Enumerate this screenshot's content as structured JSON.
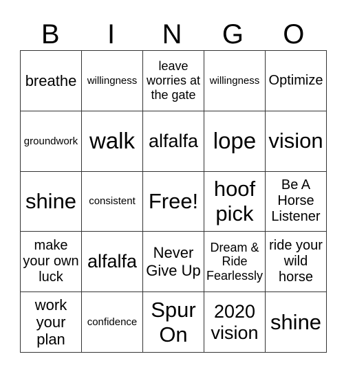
{
  "title_letters": [
    "B",
    "I",
    "N",
    "G",
    "O"
  ],
  "rows": [
    [
      "breathe",
      "willingness",
      "leave worries at the gate",
      "willingness",
      "Optimize"
    ],
    [
      "groundwork",
      "walk",
      "alfalfa",
      "lope",
      "vision"
    ],
    [
      "shine",
      "consistent",
      "Free!",
      "hoof pick",
      "Be A Horse Listener"
    ],
    [
      "make your own luck",
      "alfalfa",
      "Never Give Up",
      "Dream & Ride Fearlessly",
      "ride your wild horse"
    ],
    [
      "work your plan",
      "confidence",
      "Spur On",
      "2020 vision",
      "shine"
    ]
  ]
}
